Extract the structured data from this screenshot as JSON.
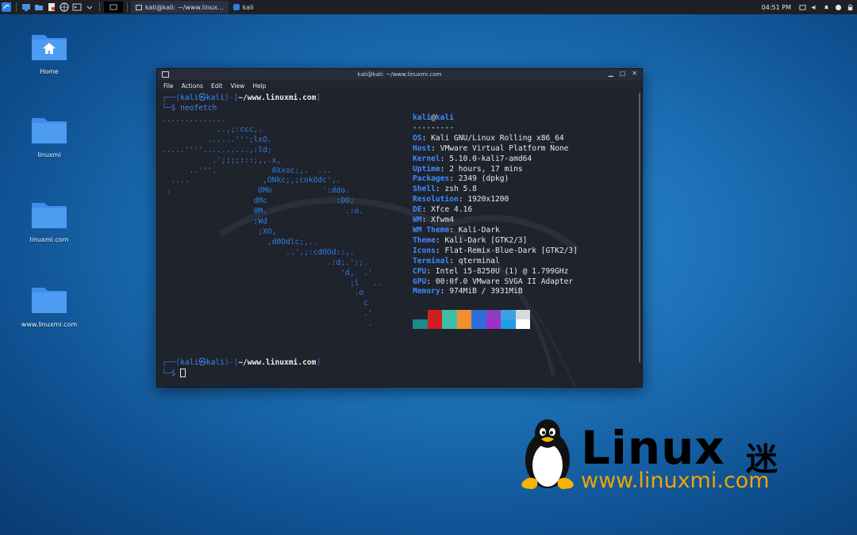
{
  "panel": {
    "tasks": [
      {
        "label": "kali@kali: ~/www.linux...",
        "active": true
      },
      {
        "label": "kali",
        "active": false
      }
    ],
    "clock": "04:51 PM"
  },
  "desktop": {
    "icons": [
      {
        "label": "Home",
        "type": "home-folder"
      },
      {
        "label": "linuxmi",
        "type": "folder"
      },
      {
        "label": "linuxmi.com",
        "type": "folder"
      },
      {
        "label": "www.linuxmi.com",
        "type": "folder"
      }
    ]
  },
  "terminal": {
    "title": "kali@kali: ~/www.linuxmi.com",
    "menu": [
      "File",
      "Actions",
      "Edit",
      "View",
      "Help"
    ],
    "prompt1": {
      "open": "┌──(",
      "user": "kali㉿kali",
      "mid": ")-[",
      "path": "~/www.linuxmi.com",
      "close": "]",
      "dollar": "└─$ ",
      "command": "neofetch"
    },
    "prompt2": {
      "open": "┌──(",
      "user": "kali㉿kali",
      "mid": ")-[",
      "path": "~/www.linuxmi.com",
      "close": "]",
      "dollar": "└─$ "
    },
    "ascii_art": "..............\n            ..,;:ccc,.\n          ......''';lxO.\n.....''''..........,:ld;\n           .';;;;:::;,,.x,\n      ..'''.            0Xxoc:,.  ...\n  ....                ,ONkc;,;cokOdc',.\n .                   OMo           ':ddo.\n                    dMc               :OO;\n                    0M.                 .:o.\n                    ;Wd\n                     ;XO,\n                       ,d0Odlc;,..\n                           ..',;:cdOOd::,.\n                                    .:d;.':;.\n                                       'd,  .'\n                                         ;l   ..\n                                          .o\n                                            c\n                                            .'\n                                             .",
    "user_host": {
      "user": "kali",
      "at": "@",
      "host": "kali"
    },
    "divider": "---------",
    "info": [
      {
        "key": "OS",
        "value": "Kali GNU/Linux Rolling x86_64"
      },
      {
        "key": "Host",
        "value": "VMware Virtual Platform None"
      },
      {
        "key": "Kernel",
        "value": "5.10.0-kali7-amd64"
      },
      {
        "key": "Uptime",
        "value": "2 hours, 17 mins"
      },
      {
        "key": "Packages",
        "value": "2349 (dpkg)"
      },
      {
        "key": "Shell",
        "value": "zsh 5.8"
      },
      {
        "key": "Resolution",
        "value": "1920x1200"
      },
      {
        "key": "DE",
        "value": "Xfce 4.16"
      },
      {
        "key": "WM",
        "value": "Xfwm4"
      },
      {
        "key": "WM Theme",
        "value": "Kali-Dark"
      },
      {
        "key": "Theme",
        "value": "Kali-Dark [GTK2/3]"
      },
      {
        "key": "Icons",
        "value": "Flat-Remix-Blue-Dark [GTK2/3]"
      },
      {
        "key": "Terminal",
        "value": "qterminal"
      },
      {
        "key": "CPU",
        "value": "Intel i5-8250U (1) @ 1.799GHz"
      },
      {
        "key": "GPU",
        "value": "00:0f.0 VMware SVGA II Adapter"
      },
      {
        "key": "Memory",
        "value": "974MiB / 3931MiB"
      }
    ],
    "palette": {
      "top": [
        "#1f232c",
        "#d01e1e",
        "#3fbfa6",
        "#f0902e",
        "#2f6ed8",
        "#8a3fbf",
        "#3ea2e0",
        "#d6d9de"
      ],
      "bottom": [
        "#1e8a8a",
        "#d01e1e",
        "#3fbfa6",
        "#f0902e",
        "#2f6ed8",
        "#a02fc8",
        "#1f9ee8",
        "#ffffff"
      ]
    }
  },
  "logo": {
    "word": "Linux",
    "cn": "迷",
    "url": "www.linuxmi.com"
  }
}
